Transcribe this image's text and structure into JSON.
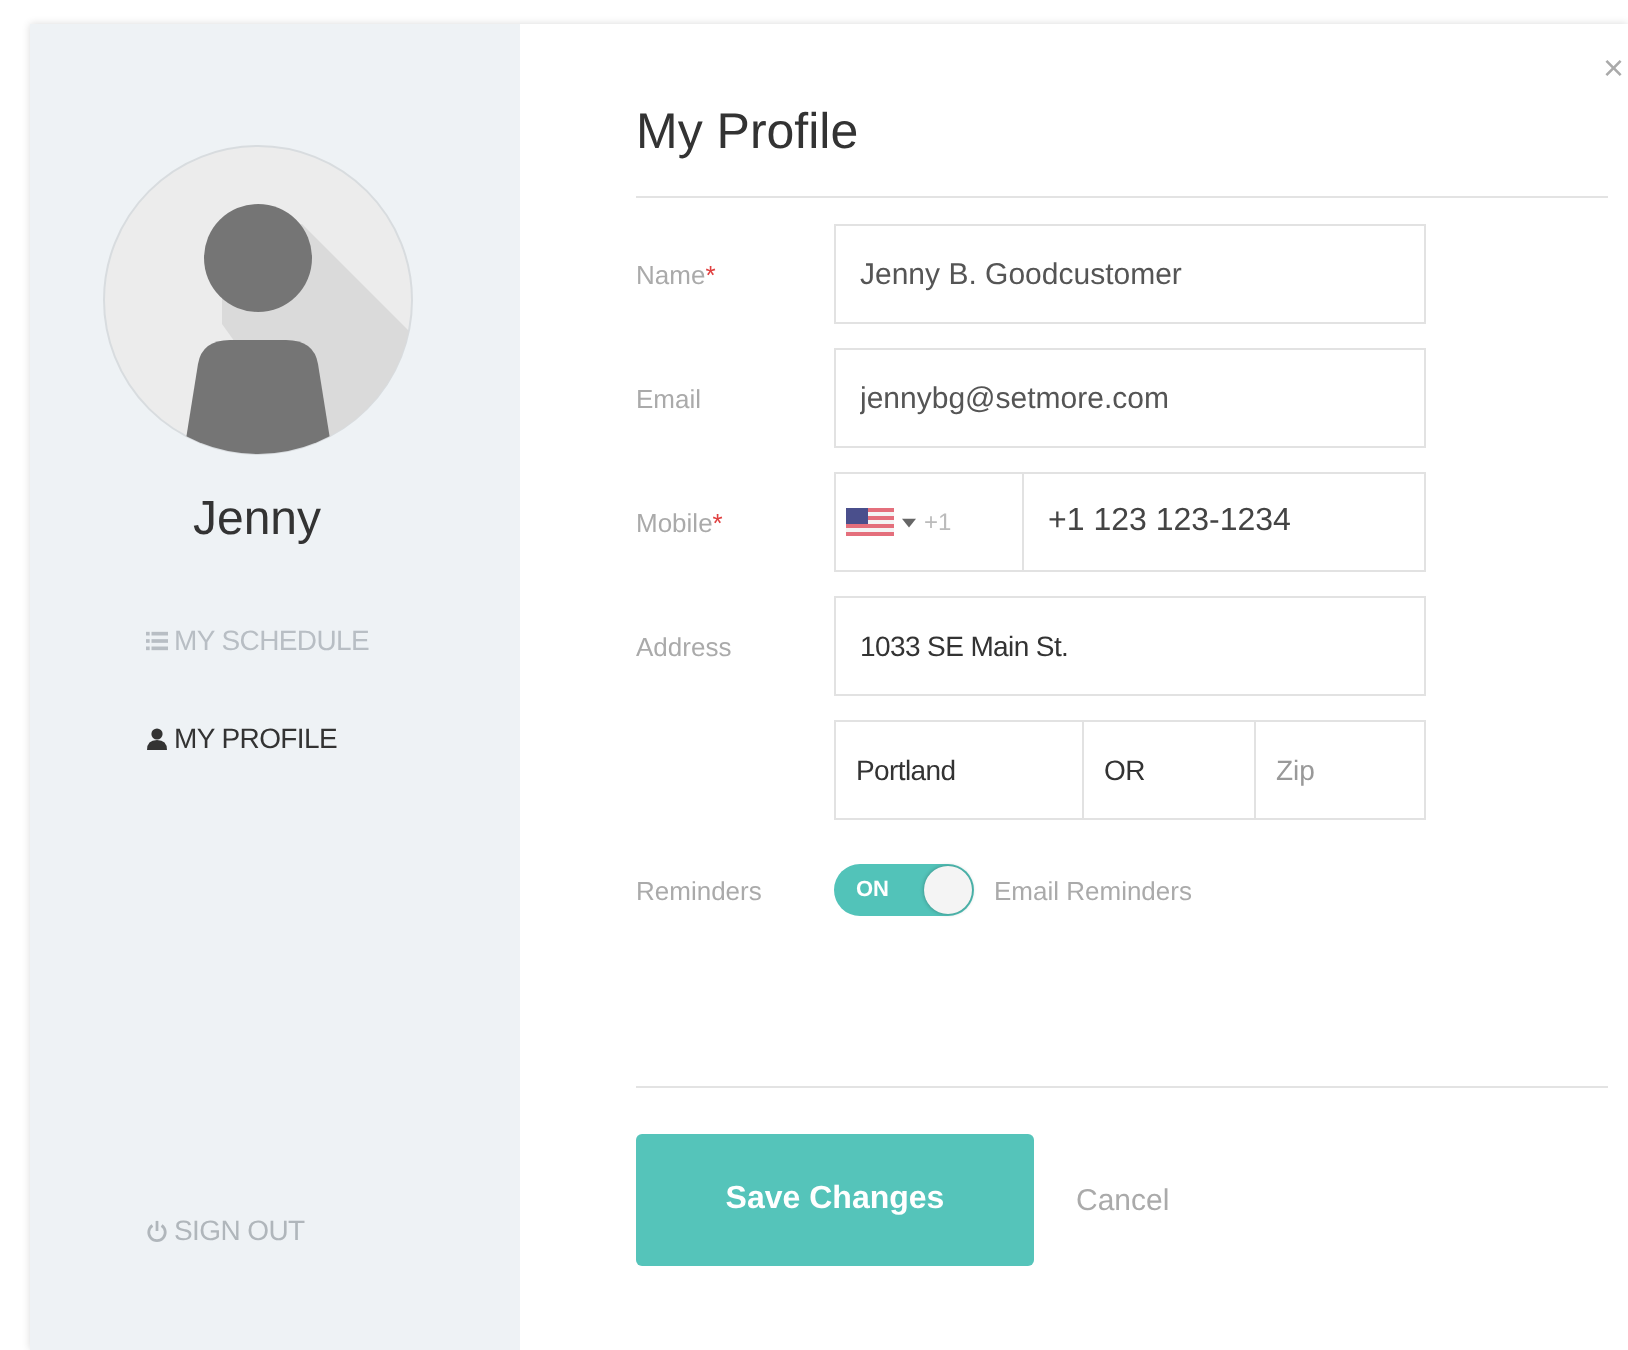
{
  "sidebar": {
    "user_name": "Jenny",
    "nav": [
      {
        "label": "MY SCHEDULE",
        "selected": false
      },
      {
        "label": "MY PROFILE",
        "selected": true
      }
    ],
    "sign_out": "SIGN OUT"
  },
  "dialog": {
    "title": "My Profile",
    "close": "×"
  },
  "fields": [
    {
      "kind": "text",
      "label": "Name",
      "required_mark": "*",
      "value": "Jenny B. Goodcustomer"
    },
    {
      "kind": "text",
      "label": "Email",
      "value": "jennybg@setmore.com"
    },
    {
      "kind": "phone",
      "label": "Mobile",
      "required_mark": "*",
      "country_code": "+1",
      "value": "+1 123 123-1234"
    },
    {
      "kind": "address",
      "label": "Address",
      "value": "1033 SE Main St.",
      "city": "Portland",
      "state": "OR",
      "zip": {
        "placeholder": "Zip"
      }
    }
  ],
  "reminders": {
    "label": "Reminders",
    "toggle_text": "ON",
    "on": true,
    "option": "Email Reminders"
  },
  "buttons": {
    "save": "Save Changes",
    "cancel": "Cancel"
  }
}
